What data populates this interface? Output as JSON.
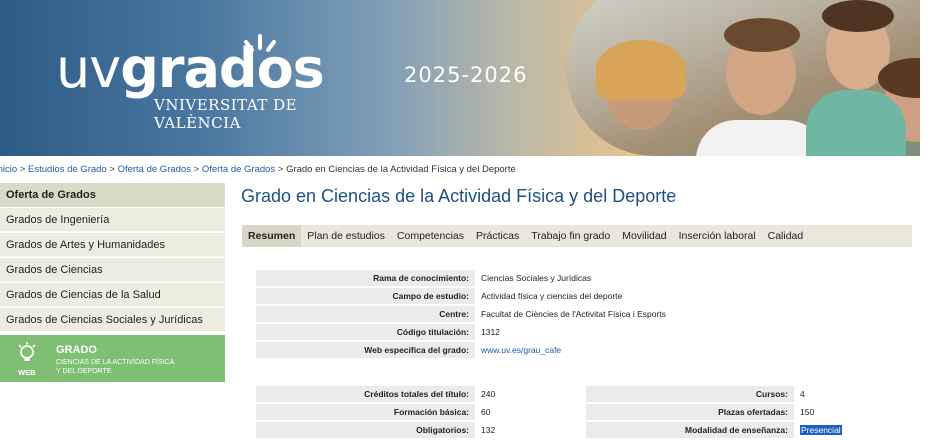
{
  "banner": {
    "logo_uv": "uv",
    "logo_grados": "grados",
    "logo_university": "VNIVERSITAT DE VALÈNCIA",
    "year": "2025-2026"
  },
  "breadcrumb": {
    "items": [
      "Inicio",
      "Estudios de Grado",
      "Oferta de Grados",
      "Oferta de Grados"
    ],
    "separator": ">",
    "current": "Grado en Ciencias de la Actividad Física y del Deporte"
  },
  "sidebar": {
    "header": "Oferta de Grados",
    "items": [
      "Grados de Ingeniería",
      "Grados de Artes y Humanidades",
      "Grados de Ciencias",
      "Grados de Ciencias de la Salud",
      "Grados de Ciencias Sociales y Jurídicas"
    ],
    "web_banner": {
      "web_label": "WEB",
      "title": "GRADO",
      "subtitle_line1": "CIENCIAS DE LA ACTIVIDAD FÍSICA",
      "subtitle_line2": "Y DEL DEPORTE"
    }
  },
  "main": {
    "title": "Grado en Ciencias de la Actividad Física y del Deporte",
    "tabs": [
      "Resumen",
      "Plan de estudios",
      "Competencias",
      "Prácticas",
      "Trabajo fin grado",
      "Movilidad",
      "Inserción laboral",
      "Calidad"
    ],
    "active_tab": "Resumen",
    "info1": [
      {
        "label": "Rama de conocimiento:",
        "value": "Ciencias Sociales y Jurídicas"
      },
      {
        "label": "Campo de estudio:",
        "value": "Actividad física y ciencias del deporte"
      },
      {
        "label": "Centre:",
        "value": "Facultat de Ciències de l'Activitat Física i Esports"
      },
      {
        "label": "Código titulación:",
        "value": "1312"
      },
      {
        "label": "Web específica del grado:",
        "value": "www.uv.es/grau_cafe"
      }
    ],
    "info2_left": [
      {
        "label": "Créditos totales del título:",
        "value": "240"
      },
      {
        "label": "Formación básica:",
        "value": "60"
      },
      {
        "label": "Obligatorios:",
        "value": "132"
      }
    ],
    "info2_right": [
      {
        "label": "Cursos:",
        "value": "4"
      },
      {
        "label": "Plazas ofertadas:",
        "value": "150"
      },
      {
        "label": "Modalidad de enseñanza:",
        "value": "Presencial"
      }
    ]
  },
  "colors": {
    "title_blue": "#1f4f86",
    "link_blue": "#1b5fa7",
    "web_green": "#7fbf73",
    "sidebar_bg": "#ededdf"
  }
}
